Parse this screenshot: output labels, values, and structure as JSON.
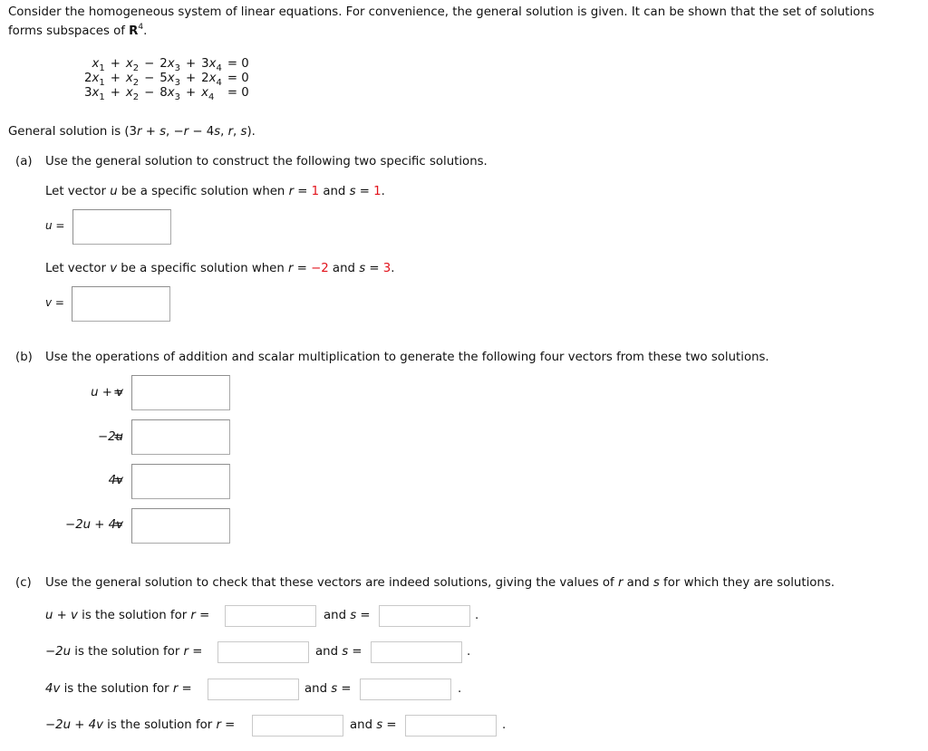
{
  "intro": {
    "line1": "Consider the homogeneous system of linear equations. For convenience, the general solution is given. It can be shown that the set of solutions",
    "line2_pre": "forms subspaces of ",
    "line2_R": "R",
    "line2_exp": "4",
    "line2_post": "."
  },
  "equations": [
    {
      "c1": "x",
      "c1coef": "",
      "c2coef": "",
      "op3": "−",
      "c3coef": "2",
      "op4": "+",
      "c4coef": "3",
      "rhs": "= 0"
    },
    {
      "c1": "x",
      "c1coef": "2",
      "c2coef": "",
      "op3": "−",
      "c3coef": "5",
      "op4": "+",
      "c4coef": "2",
      "rhs": "= 0"
    },
    {
      "c1": "x",
      "c1coef": "3",
      "c2coef": "",
      "op3": "−",
      "c3coef": "8",
      "op4": "+",
      "c4coef": "",
      "rhs": "= 0"
    }
  ],
  "general_solution": {
    "pre": "General solution is (3",
    "r1": "r",
    "mid1": " + ",
    "s1": "s",
    "mid2": ", −",
    "r2": "r",
    "mid3": " − 4",
    "s2": "s",
    "mid4": ", ",
    "r3": "r",
    "mid5": ", ",
    "s3": "s",
    "post": ")."
  },
  "part_a": {
    "label": "(a)",
    "text": "Use the general solution to construct the following two specific solutions.",
    "u_prompt": {
      "pre": "Let vector ",
      "var": "u",
      "mid": " be a specific solution when ",
      "r": "r",
      "eq1": " = ",
      "rval": "1",
      "and": " and ",
      "s": "s",
      "eq2": " = ",
      "sval": "1",
      "post": "."
    },
    "u_label": "u",
    "u_eq": " =",
    "u_value": "",
    "v_prompt": {
      "pre": "Let vector ",
      "var": "v",
      "mid": " be a specific solution when ",
      "r": "r",
      "eq1": " = ",
      "rval": "−2",
      "and": " and ",
      "s": "s",
      "eq2": " = ",
      "sval": "3",
      "post": "."
    },
    "v_label": "v",
    "v_eq": " =",
    "v_value": ""
  },
  "part_b": {
    "label": "(b)",
    "text": "Use the operations of addition and scalar multiplication to generate the following four vectors from these two solutions.",
    "rows": [
      {
        "expr": "u + v",
        "eq": "=",
        "value": ""
      },
      {
        "expr": "−2u",
        "eq": "=",
        "value": ""
      },
      {
        "expr": "4v",
        "eq": "=",
        "value": ""
      },
      {
        "expr": "−2u + 4v",
        "eq": "=",
        "value": ""
      }
    ]
  },
  "part_c": {
    "label": "(c)",
    "text_pre": "Use the general solution to check that these vectors are indeed solutions, giving the values of ",
    "text_r": "r",
    "text_and": " and ",
    "text_s": "s",
    "text_post": " for which they are solutions.",
    "rows": [
      {
        "expr": "u + v",
        "mid": " is the solution for ",
        "r": "r",
        "eq": " =",
        "and": "and ",
        "s": "s",
        "eq2": " =",
        "r_value": "",
        "s_value": "",
        "end": "."
      },
      {
        "expr": "−2u",
        "mid": " is the solution for ",
        "r": "r",
        "eq": " =",
        "and": "and ",
        "s": "s",
        "eq2": " =",
        "r_value": "",
        "s_value": "",
        "end": "."
      },
      {
        "expr": "4v",
        "mid": " is the solution for ",
        "r": "r",
        "eq": " =",
        "and": "and ",
        "s": "s",
        "eq2": " =",
        "r_value": "",
        "s_value": "",
        "end": "."
      },
      {
        "expr": "−2u + 4v",
        "mid": " is the solution for ",
        "r": "r",
        "eq": " =",
        "and": "and ",
        "s": "s",
        "eq2": " =",
        "r_value": "",
        "s_value": "",
        "end": "."
      }
    ]
  }
}
